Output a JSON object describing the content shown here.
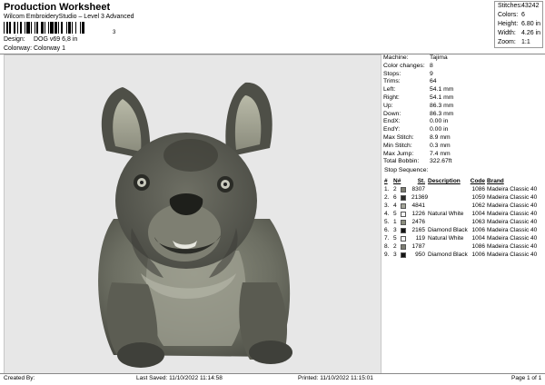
{
  "header": {
    "title": "Production Worksheet",
    "subtitle": "Wilcom EmbroideryStudio – Level 3 Advanced",
    "barcode_suffix": "3",
    "design_label": "Design:",
    "design_value": "DOG  v69 6,8 in",
    "colorway_label": "Colorway:",
    "colorway_value": "Colorway 1"
  },
  "summary": [
    {
      "label": "Stitches:",
      "value": "43242"
    },
    {
      "label": "Colors:",
      "value": "6"
    },
    {
      "label": "Height:",
      "value": "6.80 in"
    },
    {
      "label": "Width:",
      "value": "4.26 in"
    },
    {
      "label": "Zoom:",
      "value": "1:1"
    }
  ],
  "machine_info": [
    {
      "label": "Machine:",
      "value": "Tajima"
    },
    {
      "label": "Color changes:",
      "value": "8"
    },
    {
      "label": "Stops:",
      "value": "9"
    },
    {
      "label": "Trims:",
      "value": "64"
    },
    {
      "label": "Left:",
      "value": "54.1 mm"
    },
    {
      "label": "Right:",
      "value": "54.1 mm"
    },
    {
      "label": "Up:",
      "value": "86.3 mm"
    },
    {
      "label": "Down:",
      "value": "86.3 mm"
    },
    {
      "label": "EndX:",
      "value": "0.00 in"
    },
    {
      "label": "EndY:",
      "value": "0.00 in"
    },
    {
      "label": "Max Stitch:",
      "value": "8.9 mm"
    },
    {
      "label": "Min Stitch:",
      "value": "0.3 mm"
    },
    {
      "label": "Max Jump:",
      "value": "7.4 mm"
    },
    {
      "label": "Total Bobbin:",
      "value": "322.67ft"
    }
  ],
  "stop_sequence": {
    "title": "Stop Sequence:",
    "headers": {
      "num": "#",
      "n": "N#",
      "st": "St.",
      "desc": "Description",
      "code": "Code",
      "brand": "Brand"
    },
    "rows": [
      {
        "num": "1.",
        "n": "2",
        "color": "#7d7d72",
        "st": "8307",
        "desc": "",
        "code": "1086",
        "brand": "Madeira Classic 40"
      },
      {
        "num": "2.",
        "n": "6",
        "color": "#2c2c2a",
        "st": "21369",
        "desc": "",
        "code": "1059",
        "brand": "Madeira Classic 40"
      },
      {
        "num": "3.",
        "n": "4",
        "color": "#a3a498",
        "st": "4841",
        "desc": "",
        "code": "1062",
        "brand": "Madeira Classic 40"
      },
      {
        "num": "4.",
        "n": "5",
        "color": "#f4f4f4",
        "st": "1226",
        "desc": "Natural White",
        "code": "1004",
        "brand": "Madeira Classic 40"
      },
      {
        "num": "5.",
        "n": "1",
        "color": "#8a8c7c",
        "st": "2476",
        "desc": "",
        "code": "1063",
        "brand": "Madeira Classic 40"
      },
      {
        "num": "6.",
        "n": "3",
        "color": "#151515",
        "st": "2165",
        "desc": "Diamond Black",
        "code": "1006",
        "brand": "Madeira Classic 40"
      },
      {
        "num": "7.",
        "n": "5",
        "color": "#f4f4f4",
        "st": "119",
        "desc": "Natural White",
        "code": "1004",
        "brand": "Madeira Classic 40"
      },
      {
        "num": "8.",
        "n": "2",
        "color": "#7d7d72",
        "st": "1787",
        "desc": "",
        "code": "1086",
        "brand": "Madeira Classic 40"
      },
      {
        "num": "9.",
        "n": "3",
        "color": "#151515",
        "st": "950",
        "desc": "Diamond Black",
        "code": "1006",
        "brand": "Madeira Classic 40"
      }
    ]
  },
  "footer": {
    "created_by": "Created By:",
    "last_saved": "Last Saved: 11/10/2022 11:14:58",
    "printed": "Printed: 11/10/2022 11:15:01",
    "page": "Page 1 of 1"
  },
  "preview": {
    "subject": "french-bulldog-embroidery"
  }
}
